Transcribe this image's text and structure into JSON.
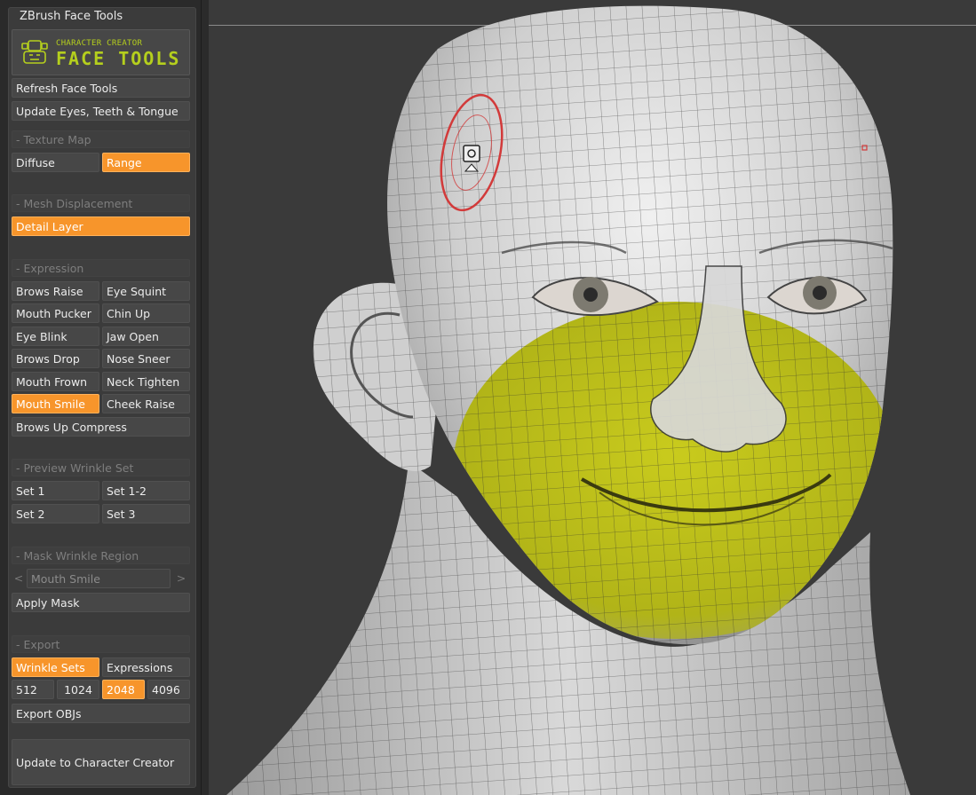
{
  "panel": {
    "title": "ZBrush Face Tools",
    "logo": {
      "line1": "CHARACTER CREATOR",
      "line2": "FACE TOOLS",
      "icon": "face-mesh-icon",
      "color": "#b5cf1d"
    },
    "refresh": "Refresh Face Tools",
    "update_eyes": "Update Eyes, Teeth & Tongue",
    "texture_map": {
      "header": "- Texture Map",
      "diffuse": "Diffuse",
      "range": "Range"
    },
    "mesh_displacement": {
      "header": "- Mesh Displacement",
      "detail_layer": "Detail Layer"
    },
    "expression": {
      "header": "- Expression",
      "items": [
        "Brows Raise",
        "Eye Squint",
        "Mouth Pucker",
        "Chin Up",
        "Eye Blink",
        "Jaw Open",
        "Brows Drop",
        "Nose Sneer",
        "Mouth Frown",
        "Neck Tighten",
        "Mouth Smile",
        "Cheek Raise",
        "Brows Up Compress"
      ],
      "selected": "Mouth Smile"
    },
    "preview_wrinkle": {
      "header": "- Preview Wrinkle Set",
      "items": [
        "Set 1",
        "Set 1-2",
        "Set 2",
        "Set 3"
      ]
    },
    "mask_region": {
      "header": "- Mask Wrinkle Region",
      "prev": "<",
      "value": "Mouth Smile",
      "next": ">",
      "apply": "Apply Mask"
    },
    "export": {
      "header": "- Export",
      "wrinkle_sets": "Wrinkle Sets",
      "expressions": "Expressions",
      "sizes": [
        "512",
        "1024",
        "2048",
        "4096"
      ],
      "selected_size": "2048",
      "export_objs": "Export OBJs"
    },
    "update_cc": "Update to Character Creator"
  },
  "colors": {
    "accent": "#f7952b",
    "mask": "#b9bb1e",
    "brush": "#d23a3a"
  },
  "viewport": {
    "brush_icon": "brush-cursor-icon"
  }
}
